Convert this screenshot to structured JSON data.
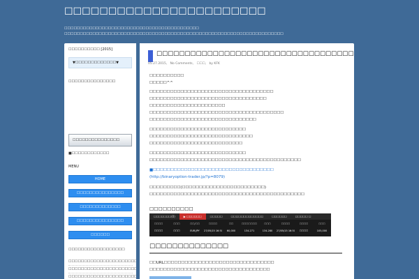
{
  "site": {
    "title": "☐☐☐☐☐☐☐☐☐☐☐☐☐☐☐☐☐☐☐☐☐☐☐",
    "tagline_1": "☐☐☐☐☐☐☐☐☐☐☐☐☐☐☐☐☐☐☐☐☐☐☐☐☐☐☐☐☐☐☐☐☐☐☐☐☐☐☐☐☐☐☐",
    "tagline_2": "☐☐☐☐☐☐☐☐☐☐☐☐☐☐☐☐☐☐☐☐☐☐☐☐☐☐☐☐☐☐☐☐☐☐☐☐☐☐☐☐☐☐☐☐☐☐☐☐☐☐☐☐☐☐☐☐☐☐☐☐☐☐☐☐☐☐☐☐☐☐"
  },
  "sidebar": {
    "section1_title": "☐☐☐☐☐☐☐☐☐☐ [2015]",
    "dropdown_label": "▼☐☐☐☐☐☐☐☐☐☐☐☐☐▼",
    "section2_title": "☐☐☐☐☐☐☐☐☐☐☐☐☐☐☐",
    "banner_label": "☐☐☐☐☐☐☐☐☐☐☐☐☐☐☐",
    "banner_caption": "■☐☐☐☐☐☐☐☐☐☐☐☐",
    "menu_title": "MENU",
    "menu": [
      {
        "label": "HOME"
      },
      {
        "label": "☐☐☐☐☐☐☐☐☐☐☐☐☐☐☐"
      },
      {
        "label": "☐☐☐☐☐☐☐☐☐☐☐☐☐"
      },
      {
        "label": "☐☐☐☐☐☐☐☐☐☐☐☐☐☐☐"
      },
      {
        "label": "☐☐☐☐☐☐"
      }
    ],
    "recent_title": "☐☐☐☐☐☐☐☐☐☐☐☐☐☐☐☐☐☐",
    "recent": [
      "☐☐☐☐☐☐☐☐☐☐☐☐☐☐☐☐☐☐☐☐☐☐☐☐☐☐☐☐☐☐☐☐☐",
      "☐☐☐☐☐☐☐☐☐☐☐☐☐☐☐☐☐☐☐☐☐☐☐☐☐☐☐☐☐☐☐☐☐",
      "☐☐☐☐☐☐☐☐☐☐☐☐☐☐☐☐☐☐☐☐☐☐☐☐☐☐☐☐☐☐☐",
      "☐☐☐☐☐☐☐☐☐☐☐☐☐☐☐☐☐☐☐☐☐☐☐☐☐"
    ]
  },
  "post": {
    "title": "☐☐☐☐☐☐☐☐☐☐☐☐☐☐☐☐☐☐☐☐☐☐☐☐☐☐☐☐☐☐☐☐☐☐☐☐☐☐",
    "date": "05.27.2015,",
    "comments": "No Comments,",
    "category": "☐☐☐,",
    "author": "by KFK",
    "lines": [
      "☐☐☐☐☐☐☐☐☐☐",
      "☐☐☐☐☐^^",
      "☐☐☐☐☐☐☐☐☐☐☐☐☐☐☐☐☐☐☐☐☐☐☐☐☐☐☐☐☐☐☐☐☐☐☐☐",
      "☐☐☐☐☐☐☐☐☐☐☐☐☐☐☐☐☐☐☐☐☐☐☐☐☐☐☐☐☐☐☐☐☐☐",
      "☐☐☐☐☐☐☐☐☐☐☐☐☐☐☐☐☐☐☐☐☐☐",
      "☐☐☐☐☐☐☐☐☐☐☐☐☐☐☐☐☐☐☐☐☐☐☐☐☐☐☐☐☐☐☐☐☐☐☐☐☐☐☐",
      "☐☐☐☐☐☐☐☐☐☐☐☐☐☐☐☐☐☐☐☐☐☐☐☐☐☐☐☐☐☐☐",
      "☐☐☐☐☐☐☐☐☐☐☐☐☐☐☐☐☐☐☐☐☐☐☐☐☐☐☐☐",
      "☐☐☐☐☐☐☐☐☐☐☐☐☐☐☐☐☐☐☐☐☐☐☐☐☐☐☐☐☐☐",
      "☐☐☐☐☐☐☐☐☐☐☐☐☐☐☐☐☐☐☐☐☐☐☐☐☐☐☐",
      "☐☐☐☐☐☐☐☐☐☐☐☐☐☐☐☐☐☐☐☐☐☐☐☐☐☐☐☐",
      "☐☐☐☐☐☐☐☐☐☐☐☐☐☐☐☐☐☐☐☐☐☐☐☐☐☐☐☐☐☐☐☐☐☐☐☐☐☐☐☐☐☐☐☐"
    ],
    "link_text": "■☐☐☐☐☐☐☐☐☐☐☐☐☐☐☐☐☐☐☐☐☐☐☐☐☐☐☐☐☐☐☐☐☐☐☐",
    "link_url": "(http://binaryoption-trader.jp/?p=8079)",
    "lines_after": [
      "☐☐☐☐☐☐☐☐☐(☐☐☐☐☐☐☐☐☐☐☐☐☐☐☐☐☐☐☐☐☐☐☐☐)",
      "☐☐☐☐☐☐☐☐☐☐☐☐☐☐☐☐☐☐☐☐☐☐☐☐☐☐☐☐☐☐☐☐☐☐☐☐☐☐☐☐☐☐☐☐☐"
    ],
    "subheading": "☐☐☐☐☐☐☐☐☐☐",
    "trade_tabs": [
      "☐☐☐☐☐☐☐(0)",
      "▶ ☐☐☐☐☐☐",
      "☐☐☐☐☐",
      "☐☐☐☐☐☐☐☐☐☐☐☐☐",
      "☐☐☐☐☐☐",
      "☐☐☐☐☐ ☐"
    ],
    "trade_headers": [
      "☐☐☐☐",
      "☐☐☐",
      "☐☐/☐☐",
      "☐☐☐☐",
      "☐☐",
      "☐☐☐☐☐☐☐",
      "☐☐☐",
      "☐☐☐☐",
      "☐☐☐☐",
      "☐☐☐"
    ],
    "trade_rows": [
      [
        "☐☐☐☐",
        "☐☐☐",
        "EUR/JPY",
        "27/05/15 16:50",
        "60,000",
        "134.271",
        "134.280",
        "27/05/15 16:50",
        "☐☐☐☐",
        "105,000"
      ]
    ],
    "h2": "☐☐☐☐☐☐☐☐☐☐☐☐☐☐",
    "foot_lines": [
      "☐☐URL☐☐☐☐☐☐☐☐☐☐☐☐☐☐☐☐☐☐☐☐☐☐☐☐☐☐☐☐☐☐☐☐",
      "☐☐☐☐☐☐☐☐☐☐☐☐☐☐☐☐☐☐☐☐☐☐☐☐☐☐☐☐☐☐☐☐☐☐☐"
    ]
  }
}
